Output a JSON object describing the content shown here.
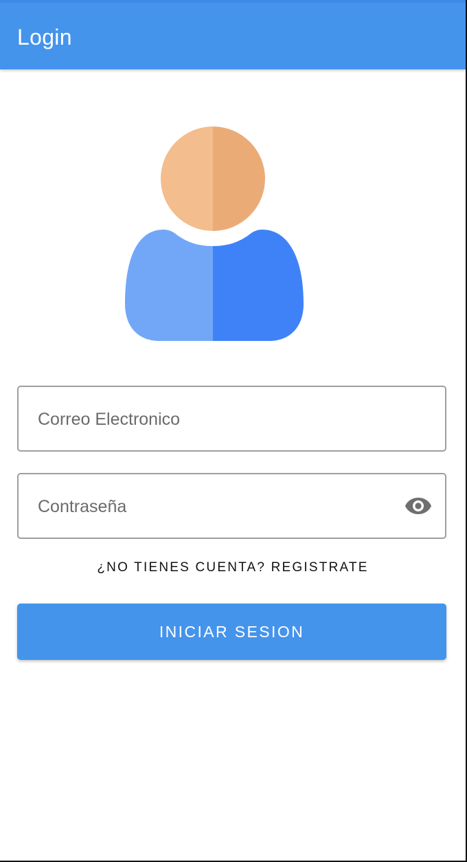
{
  "appbar": {
    "title": "Login",
    "color": "#4594ec"
  },
  "avatar": {
    "icon": "user-avatar-icon",
    "colors": {
      "head_light": "#f3bd8d",
      "head_dark": "#ebab77",
      "body_light": "#72a7f7",
      "body_dark": "#3f82f8"
    }
  },
  "form": {
    "email": {
      "placeholder": "Correo Electronico",
      "value": ""
    },
    "password": {
      "placeholder": "Contraseña",
      "value": "",
      "toggle_icon": "eye-icon"
    },
    "register_link": "¿NO TIENES CUENTA? REGISTRATE",
    "submit_label": "INICIAR SESION"
  }
}
